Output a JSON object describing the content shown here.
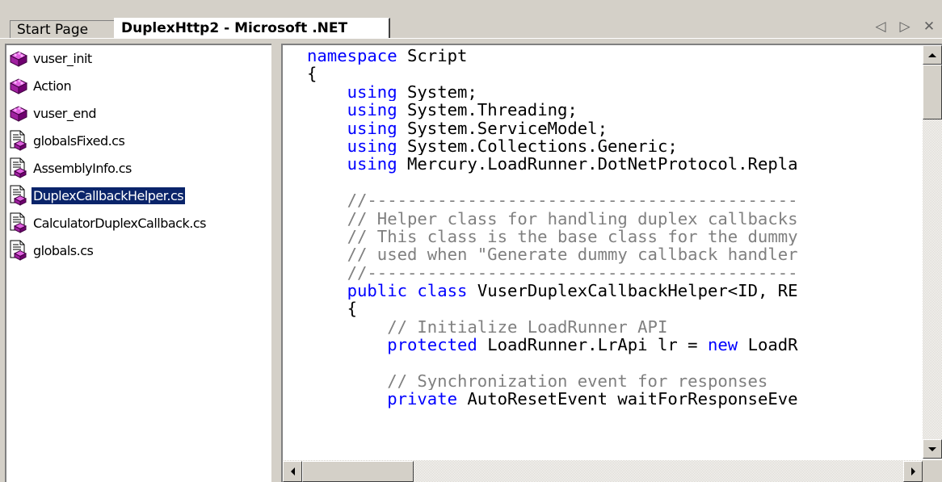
{
  "tabs": [
    {
      "label": "Start Page",
      "active": false
    },
    {
      "label": "DuplexHttp2 - Microsoft .NET",
      "active": true
    }
  ],
  "tab_nav": {
    "prev": "◁",
    "next": "▷",
    "close": "✕"
  },
  "files": [
    {
      "label": "vuser_init",
      "icon": "action-cube-icon",
      "selected": false
    },
    {
      "label": "Action",
      "icon": "action-cube-icon",
      "selected": false
    },
    {
      "label": "vuser_end",
      "icon": "action-cube-icon",
      "selected": false
    },
    {
      "label": "globalsFixed.cs",
      "icon": "cs-file-icon",
      "selected": false
    },
    {
      "label": "AssemblyInfo.cs",
      "icon": "cs-file-icon",
      "selected": false
    },
    {
      "label": "DuplexCallbackHelper.cs",
      "icon": "cs-file-icon",
      "selected": true
    },
    {
      "label": "CalculatorDuplexCallback.cs",
      "icon": "cs-file-icon",
      "selected": false
    },
    {
      "label": "globals.cs",
      "icon": "cs-file-icon",
      "selected": false
    }
  ],
  "code_lines": [
    [
      {
        "t": "namespace",
        "c": "kw"
      },
      {
        "t": " Script",
        "c": ""
      }
    ],
    [
      {
        "t": "{",
        "c": ""
      }
    ],
    [
      {
        "t": "    ",
        "c": ""
      },
      {
        "t": "using",
        "c": "kw"
      },
      {
        "t": " System;",
        "c": ""
      }
    ],
    [
      {
        "t": "    ",
        "c": ""
      },
      {
        "t": "using",
        "c": "kw"
      },
      {
        "t": " System.Threading;",
        "c": ""
      }
    ],
    [
      {
        "t": "    ",
        "c": ""
      },
      {
        "t": "using",
        "c": "kw"
      },
      {
        "t": " System.ServiceModel;",
        "c": ""
      }
    ],
    [
      {
        "t": "    ",
        "c": ""
      },
      {
        "t": "using",
        "c": "kw"
      },
      {
        "t": " System.Collections.Generic;",
        "c": ""
      }
    ],
    [
      {
        "t": "    ",
        "c": ""
      },
      {
        "t": "using",
        "c": "kw"
      },
      {
        "t": " Mercury.LoadRunner.DotNetProtocol.Repla",
        "c": ""
      }
    ],
    [
      {
        "t": "",
        "c": ""
      }
    ],
    [
      {
        "t": "    //-------------------------------------------",
        "c": "cm"
      }
    ],
    [
      {
        "t": "    // Helper class for handling duplex callbacks",
        "c": "cm"
      }
    ],
    [
      {
        "t": "    // This class is the base class for the dummy",
        "c": "cm"
      }
    ],
    [
      {
        "t": "    // used when \"Generate dummy callback handler",
        "c": "cm"
      }
    ],
    [
      {
        "t": "    //-------------------------------------------",
        "c": "cm"
      }
    ],
    [
      {
        "t": "    ",
        "c": ""
      },
      {
        "t": "public",
        "c": "kw"
      },
      {
        "t": " ",
        "c": ""
      },
      {
        "t": "class",
        "c": "kw"
      },
      {
        "t": " VuserDuplexCallbackHelper<ID, RE",
        "c": ""
      }
    ],
    [
      {
        "t": "    {",
        "c": ""
      }
    ],
    [
      {
        "t": "        // Initialize LoadRunner API",
        "c": "cm"
      }
    ],
    [
      {
        "t": "        ",
        "c": ""
      },
      {
        "t": "protected",
        "c": "kw"
      },
      {
        "t": " LoadRunner.LrApi lr = ",
        "c": ""
      },
      {
        "t": "new",
        "c": "kw"
      },
      {
        "t": " LoadR",
        "c": ""
      }
    ],
    [
      {
        "t": "",
        "c": ""
      }
    ],
    [
      {
        "t": "        // Synchronization event for responses",
        "c": "cm"
      }
    ],
    [
      {
        "t": "        ",
        "c": ""
      },
      {
        "t": "private",
        "c": "kw"
      },
      {
        "t": " AutoResetEvent waitForResponseEve",
        "c": ""
      }
    ]
  ],
  "colors": {
    "keyword": "#0000ff",
    "comment": "#808080",
    "selection": "#0a246a",
    "chrome": "#d4d0c8"
  }
}
